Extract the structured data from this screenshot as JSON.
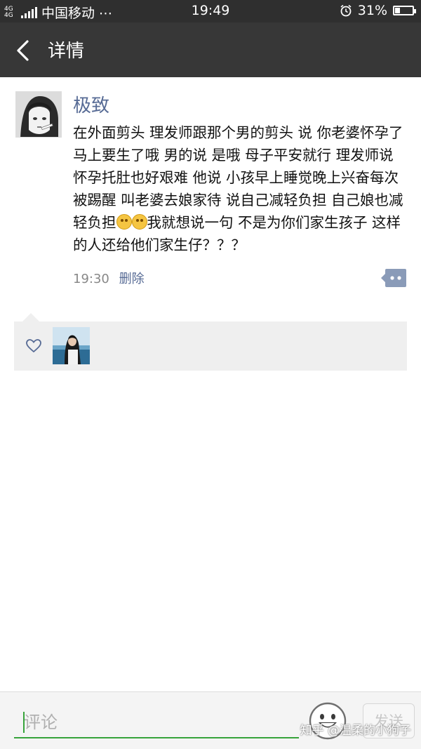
{
  "status_bar": {
    "network_badge_top": "4G",
    "network_badge_bottom": "4G",
    "carrier": "中国移动 ⋯",
    "time": "19:49",
    "battery_percent": "31%",
    "battery_level": 0.31
  },
  "header": {
    "back_icon": "chevron-left-icon",
    "title": "详情"
  },
  "post": {
    "username": "极致",
    "text_part1": "在外面剪头 理发师跟那个男的剪头 说 你老婆怀孕了马上要生了哦 男的说 是哦 母子平安就行 理发师说 怀孕托肚也好艰难 他说 小孩早上睡觉晚上兴奋每次被踢醒 叫老婆去娘家待 说自己减轻负担 自己娘也减轻负担",
    "text_part2": "我就想说一句 不是为你们家生孩子 这样的人还给他们家生仔？？？",
    "emoji_icon": "smile-emoji-icon",
    "time": "19:30",
    "delete_label": "删除",
    "more_icon": "more-comment-icon"
  },
  "likes": {
    "heart_icon": "heart-icon"
  },
  "bottom_bar": {
    "comment_placeholder": "评论",
    "emoji_icon": "emoji-face-icon",
    "send_label": "发送",
    "watermark": "知乎 @温柔的小狗子"
  },
  "colors": {
    "link_blue": "#576b95",
    "header_bg": "#373737",
    "accent_green": "#37a33b"
  }
}
